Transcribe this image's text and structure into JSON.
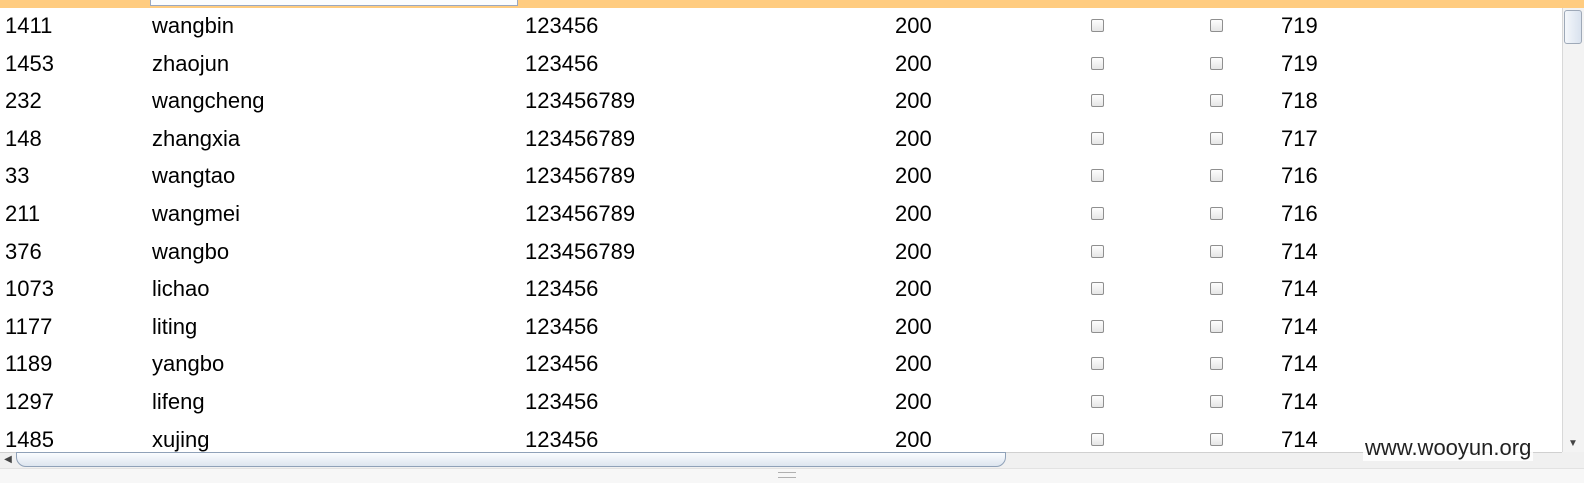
{
  "table": {
    "rows": [
      {
        "id": "1411",
        "user": "wangbin",
        "password": "123456",
        "code": "200",
        "score": "719"
      },
      {
        "id": "1453",
        "user": "zhaojun",
        "password": "123456",
        "code": "200",
        "score": "719"
      },
      {
        "id": "232",
        "user": "wangcheng",
        "password": "123456789",
        "code": "200",
        "score": "718"
      },
      {
        "id": "148",
        "user": "zhangxia",
        "password": "123456789",
        "code": "200",
        "score": "717"
      },
      {
        "id": "33",
        "user": "wangtao",
        "password": "123456789",
        "code": "200",
        "score": "716"
      },
      {
        "id": "211",
        "user": "wangmei",
        "password": "123456789",
        "code": "200",
        "score": "716"
      },
      {
        "id": "376",
        "user": "wangbo",
        "password": "123456789",
        "code": "200",
        "score": "714"
      },
      {
        "id": "1073",
        "user": "lichao",
        "password": "123456",
        "code": "200",
        "score": "714"
      },
      {
        "id": "1177",
        "user": "liting",
        "password": "123456",
        "code": "200",
        "score": "714"
      },
      {
        "id": "1189",
        "user": "yangbo",
        "password": "123456",
        "code": "200",
        "score": "714"
      },
      {
        "id": "1297",
        "user": "lifeng",
        "password": "123456",
        "code": "200",
        "score": "714"
      },
      {
        "id": "1485",
        "user": "xujing",
        "password": "123456",
        "code": "200",
        "score": "714"
      }
    ]
  },
  "watermark": "www.wooyun.org",
  "icons": {
    "scroll_left": "scroll-left-arrow-icon",
    "scroll_down": "scroll-down-arrow-icon"
  },
  "colors": {
    "header_band": "#ffcc80"
  }
}
